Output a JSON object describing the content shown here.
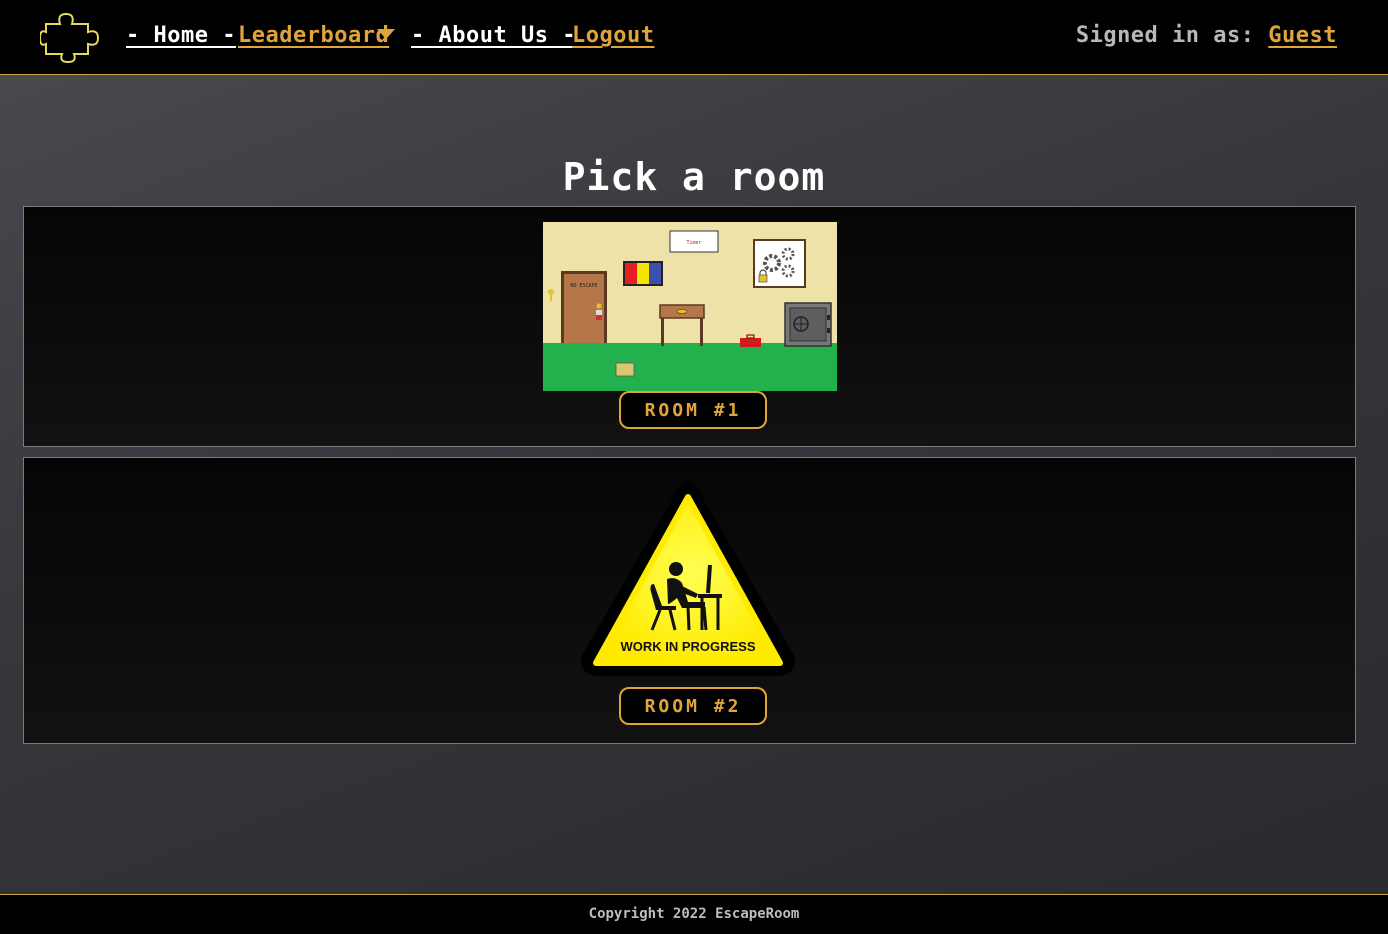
{
  "navbar": {
    "logo_icon": "puzzle-piece-icon",
    "links": [
      {
        "label": "- Home -"
      },
      {
        "label": "Leaderboard"
      },
      {
        "label": "- About Us -"
      },
      {
        "label": "Logout"
      }
    ],
    "dropdown_icon": "caret-down-icon",
    "signed_in_label": "Signed in as: ",
    "user": "Guest"
  },
  "main": {
    "title": "Pick a room",
    "rooms": [
      {
        "button_label": "ROOM #1",
        "image": {
          "door_sign": "NO ESCAPE",
          "timer_label": "Timer"
        }
      },
      {
        "button_label": "ROOM #2",
        "image": {
          "sign_text": "WORK IN PROGRESS"
        }
      }
    ]
  },
  "footer": {
    "text": "Copyright 2022 EscapeRoom"
  },
  "colors": {
    "accent": "#e0a43a",
    "navbar_bg": "#000000",
    "card_bg": "#0a0a0a",
    "floor_green": "#22b14c",
    "wall_cream": "#efe2a8",
    "warning_yellow": "#ffef00"
  }
}
